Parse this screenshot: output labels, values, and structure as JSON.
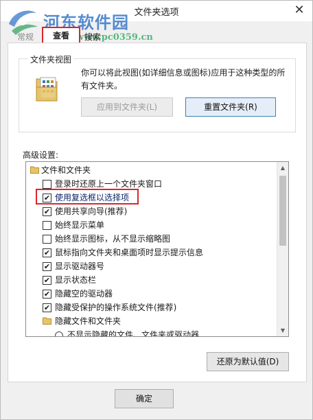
{
  "window": {
    "title": "文件夹选项",
    "close_icon": "close-icon"
  },
  "watermark": {
    "text": "河东软件园",
    "url": "www.pc0359.cn",
    "color": "#3778c8"
  },
  "tabs": [
    {
      "label": "常规"
    },
    {
      "label": "查看",
      "selected": true
    },
    {
      "label": "搜索"
    }
  ],
  "folder_views": {
    "title": "文件夹视图",
    "description": "你可以将此视图(如详细信息或图标)应用于这种类型的所有文件夹。",
    "apply_button": "应用到文件夹(L)",
    "reset_button": "重置文件夹(R)"
  },
  "advanced": {
    "label": "高级设置:",
    "items": [
      {
        "type": "folder",
        "label": "文件和文件夹"
      },
      {
        "type": "checkbox",
        "label": "登录时还原上一个文件夹窗口",
        "checked": false
      },
      {
        "type": "checkbox",
        "label": "使用复选框以选择项",
        "checked": true,
        "highlighted": true
      },
      {
        "type": "checkbox",
        "label": "使用共享向导(推荐)",
        "checked": true
      },
      {
        "type": "checkbox",
        "label": "始终显示菜单",
        "checked": false
      },
      {
        "type": "checkbox",
        "label": "始终显示图标，从不显示缩略图",
        "checked": false
      },
      {
        "type": "checkbox",
        "label": "鼠标指向文件夹和桌面项时显示提示信息",
        "checked": true
      },
      {
        "type": "checkbox",
        "label": "显示驱动器号",
        "checked": true
      },
      {
        "type": "checkbox",
        "label": "显示状态栏",
        "checked": true
      },
      {
        "type": "checkbox",
        "label": "隐藏空的驱动器",
        "checked": true
      },
      {
        "type": "checkbox",
        "label": "隐藏受保护的操作系统文件(推荐)",
        "checked": true
      },
      {
        "type": "subfolder",
        "label": "隐藏文件和文件夹"
      },
      {
        "type": "radio",
        "label": "不显示隐藏的文件、文件夹或驱动器",
        "checked": false
      }
    ],
    "restore_button": "还原为默认值(D)"
  },
  "ok_button": "确定",
  "colors": {
    "highlight": "#d9262a",
    "accent": "#3c7fb1"
  }
}
